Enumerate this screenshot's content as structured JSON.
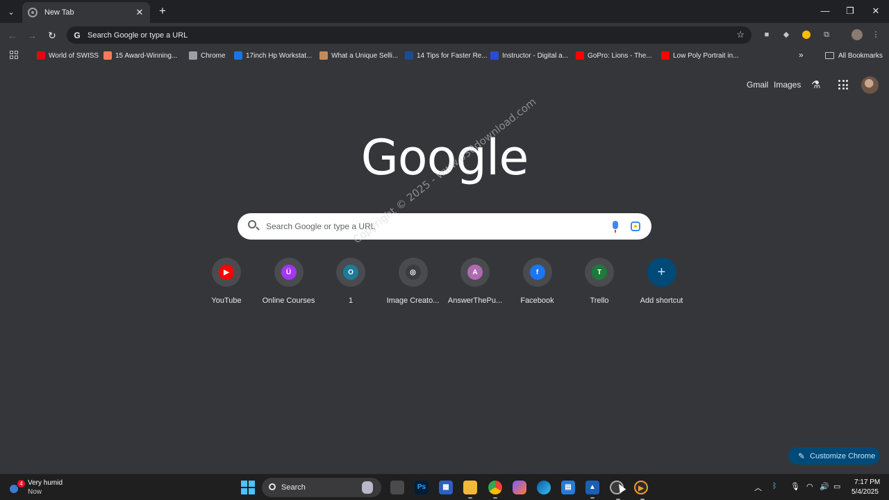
{
  "tab": {
    "title": "New Tab"
  },
  "omnibox": {
    "text": "Search Google or type a URL"
  },
  "bookmarks": [
    {
      "label": "World of SWISS",
      "icon_color": "#e30613"
    },
    {
      "label": "15 Award-Winning...",
      "icon_color": "#ff7a59"
    },
    {
      "label": "Chrome",
      "icon_color": "#9aa0a6"
    },
    {
      "label": "17inch Hp Workstat...",
      "icon_color": "#1a73e8"
    },
    {
      "label": "What a Unique Selli...",
      "icon_color": "#c48b5a"
    },
    {
      "label": "14 Tips for Faster Re...",
      "icon_color": "#1a4d8f"
    },
    {
      "label": "Instructor - Digital a...",
      "icon_color": "#2a4bd6"
    },
    {
      "label": "GoPro: Lions - The...",
      "icon_color": "#ff0000"
    },
    {
      "label": "Low Poly Portrait in...",
      "icon_color": "#ff0000"
    }
  ],
  "all_bookmarks": "All Bookmarks",
  "top_links": {
    "gmail": "Gmail",
    "images": "Images"
  },
  "logo": "Google",
  "search": {
    "placeholder": "Search Google or type a URL"
  },
  "shortcuts": [
    {
      "label": "YouTube",
      "glyph": "▶",
      "color": "#ff0000"
    },
    {
      "label": "Online Courses",
      "glyph": "Ü",
      "color": "#a435f0"
    },
    {
      "label": "1",
      "glyph": "O",
      "color": "#1e7a99"
    },
    {
      "label": "Image Creato...",
      "glyph": "◎",
      "color": "#3b3c40"
    },
    {
      "label": "AnswerThePu...",
      "glyph": "A",
      "color": "#b06ab3"
    },
    {
      "label": "Facebook",
      "glyph": "f",
      "color": "#1877f2"
    },
    {
      "label": "Trello",
      "glyph": "T",
      "color": "#1c7a3a"
    }
  ],
  "add_shortcut": {
    "label": "Add shortcut",
    "glyph": "+"
  },
  "watermark": {
    "line1": "Copyright © 2025 - www.p30download.com"
  },
  "customize": {
    "label": "Customize Chrome"
  },
  "taskbar": {
    "weather_title": "Very humid",
    "weather_sub": "Now",
    "weather_badge": "4",
    "search_label": "Search",
    "time": "7:17 PM",
    "date": "5/4/2025"
  },
  "accent": "#004a77"
}
